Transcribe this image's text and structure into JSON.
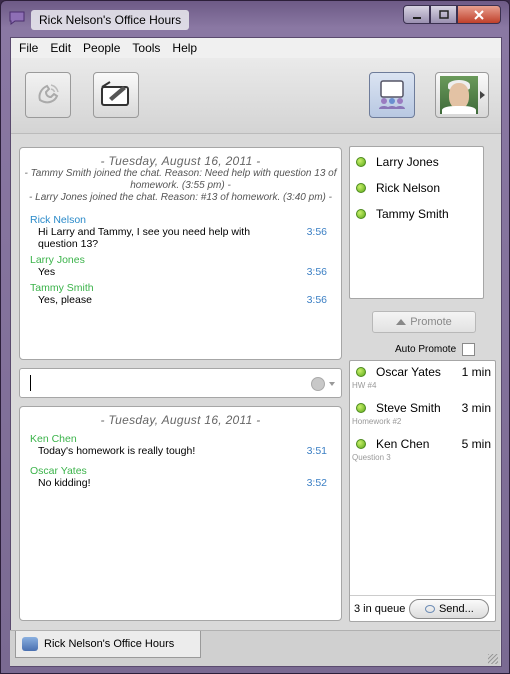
{
  "window": {
    "title": "Rick Nelson's Office Hours"
  },
  "menu": [
    "File",
    "Edit",
    "People",
    "Tools",
    "Help"
  ],
  "toolbar": {
    "icons": [
      "phone-icon",
      "whiteboard-icon",
      "roster-icon",
      "avatar"
    ]
  },
  "chat_top": {
    "date": "- Tuesday, August 16, 2011 -",
    "system_1": "- Tammy Smith joined the chat.  Reason: Need help with question 13 of homework. (3:55 pm)  -",
    "system_2": "- Larry Jones joined the chat.  Reason: #13 of homework. (3:40 pm)  -",
    "messages": [
      {
        "sender": "Rick Nelson",
        "text": "Hi Larry and Tammy, I see you need help with question 13?",
        "time": "3:56"
      },
      {
        "sender": "Larry Jones",
        "text": "Yes",
        "time": "3:56"
      },
      {
        "sender": "Tammy Smith",
        "text": "Yes, please",
        "time": "3:56"
      }
    ]
  },
  "chat_bottom": {
    "date": "- Tuesday, August 16, 2011 -",
    "messages": [
      {
        "sender": "Ken Chen",
        "text": "Today's homework is really tough!",
        "time": "3:51"
      },
      {
        "sender": "Oscar Yates",
        "text": "No kidding!",
        "time": "3:52"
      }
    ]
  },
  "participants": [
    "Larry Jones",
    "Rick Nelson",
    "Tammy Smith"
  ],
  "promote": {
    "label": "Promote",
    "auto_label": "Auto Promote"
  },
  "queue": {
    "items": [
      {
        "name": "Oscar Yates",
        "time": "1 min",
        "note": "HW #4"
      },
      {
        "name": "Steve Smith",
        "time": "3 min",
        "note": "Homework #2"
      },
      {
        "name": "Ken Chen",
        "time": "5 min",
        "note": "Question 3"
      }
    ],
    "count_label": "3 in queue",
    "send_label": "Send..."
  },
  "tab": {
    "label": "Rick Nelson's Office Hours"
  },
  "colors": {
    "accent_blue": "#2a8ac9",
    "accent_green": "#3bb34a",
    "status_online": "#5ca91a"
  }
}
